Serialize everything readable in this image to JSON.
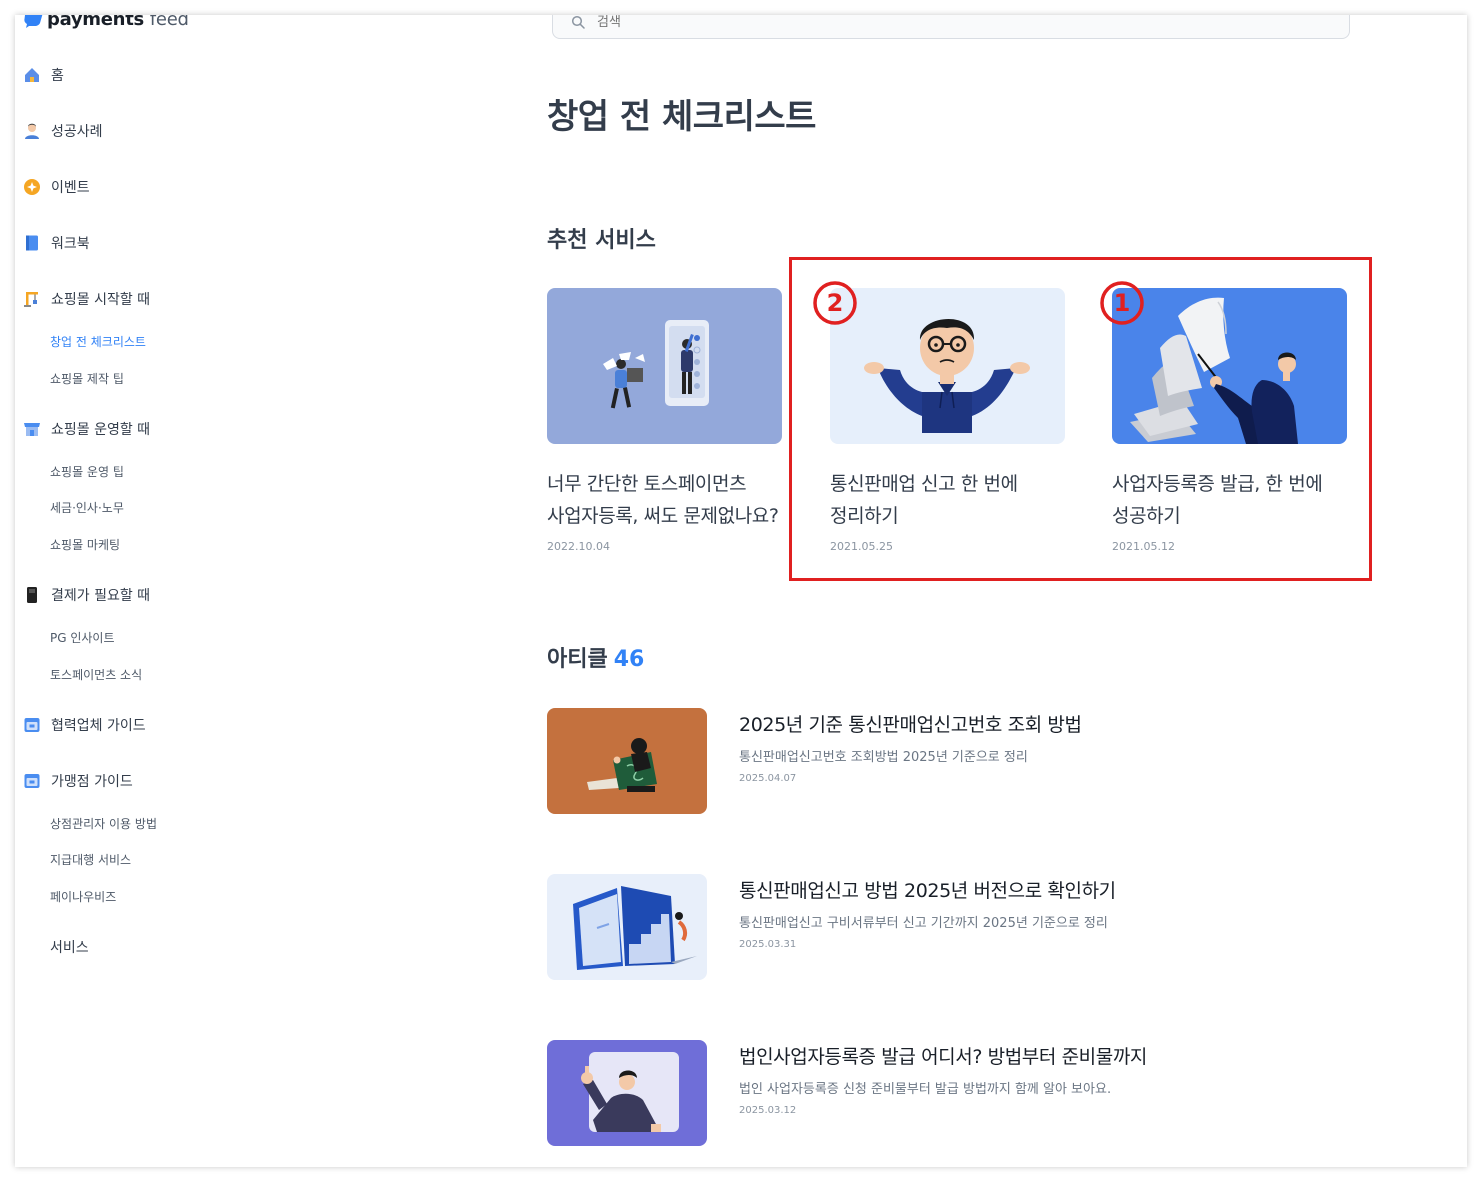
{
  "brand": {
    "name_bold": "payments",
    "name_thin": "feed"
  },
  "search": {
    "placeholder": "검색"
  },
  "sidebar": {
    "items": [
      {
        "label": "홈"
      },
      {
        "label": "성공사례"
      },
      {
        "label": "이벤트"
      },
      {
        "label": "워크북"
      },
      {
        "label": "쇼핑몰 시작할 때"
      },
      {
        "label": "쇼핑몰 운영할 때"
      },
      {
        "label": "결제가 필요할 때"
      },
      {
        "label": "협력업체 가이드"
      },
      {
        "label": "가맹점 가이드"
      }
    ],
    "sub_start": [
      "창업 전 체크리스트",
      "쇼핑몰 제작 팁"
    ],
    "sub_operate": [
      "쇼핑몰 운영 팁",
      "세금·인사·노무",
      "쇼핑몰 마케팅"
    ],
    "sub_payment": [
      "PG 인사이트",
      "토스페이먼츠 소식"
    ],
    "sub_merchant": [
      "상점관리자 이용 방법",
      "지급대행 서비스",
      "페이나우비즈"
    ],
    "service": "서비스"
  },
  "page": {
    "title": "창업 전 체크리스트"
  },
  "recommended": {
    "title": "추천 서비스",
    "cards": [
      {
        "title_line1": "너무 간단한 토스페이먼츠",
        "title_line2": "사업자등록, 써도 문제없나요?",
        "date": "2022.10.04"
      },
      {
        "title_line1": "통신판매업 신고 한 번에",
        "title_line2": "정리하기",
        "date": "2021.05.25"
      },
      {
        "title_line1": "사업자등록증 발급, 한 번에",
        "title_line2": "성공하기",
        "date": "2021.05.12"
      }
    ]
  },
  "annotations": {
    "num_left": "2",
    "num_right": "1",
    "color": "#e02020"
  },
  "articles": {
    "label": "아티클",
    "count": "46",
    "items": [
      {
        "title": "2025년 기준 통신판매업신고번호 조회 방법",
        "desc": "통신판매업신고번호 조회방법 2025년 기준으로 정리",
        "date": "2025.04.07"
      },
      {
        "title": "통신판매업신고 방법 2025년 버전으로 확인하기",
        "desc": "통신판매업신고 구비서류부터 신고 기간까지 2025년 기준으로 정리",
        "date": "2025.03.31"
      },
      {
        "title": "법인사업자등록증 발급 어디서? 방법부터 준비물까지",
        "desc": "법인 사업자등록증 신청 준비물부터 발급 방법까지 함께 알아 보아요.",
        "date": "2025.03.12"
      }
    ]
  },
  "colors": {
    "accent": "#3182f6",
    "text": "#333d4b",
    "muted": "#8b95a1"
  }
}
